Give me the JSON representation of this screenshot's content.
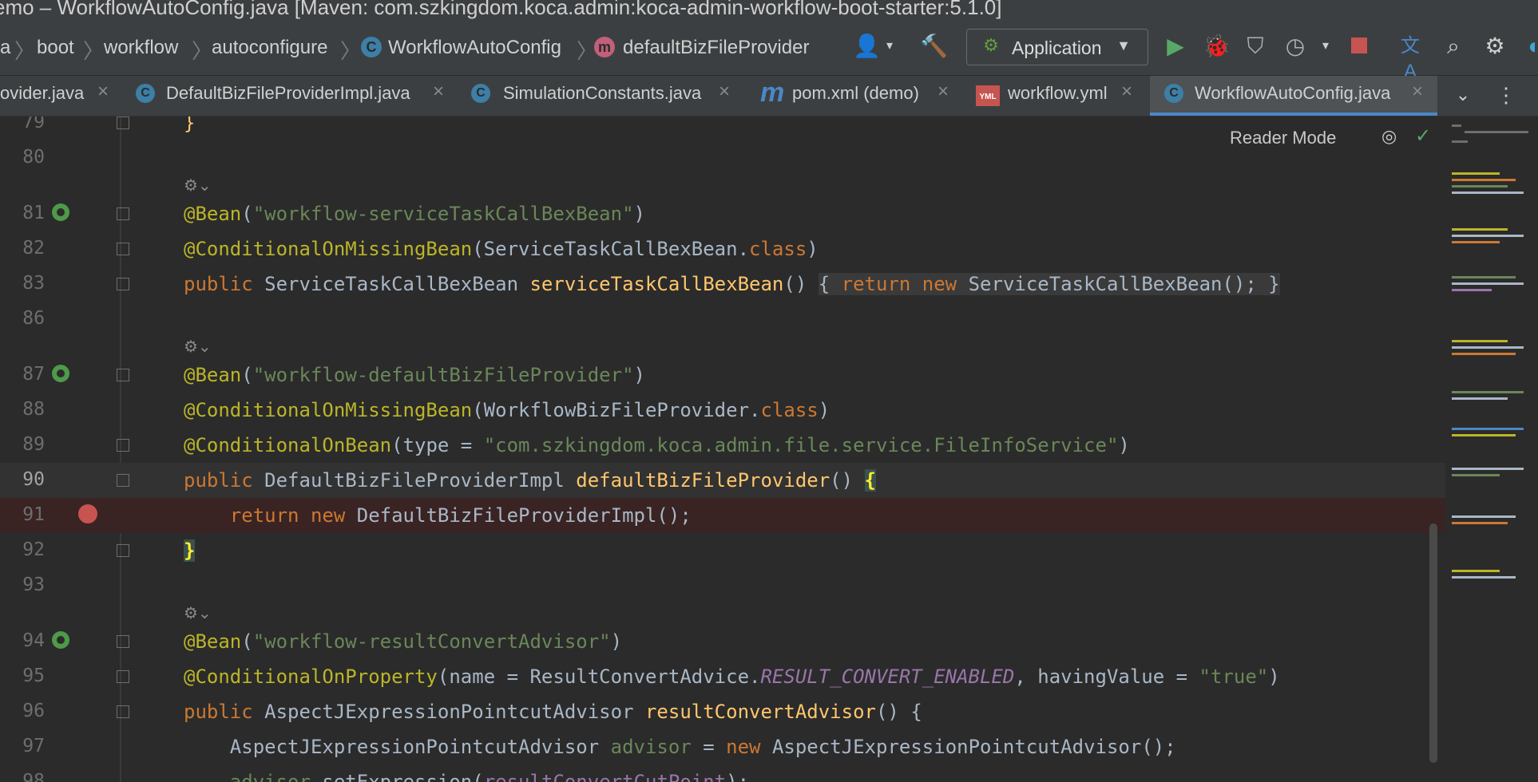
{
  "window": {
    "title": "emo – WorkflowAutoConfig.java [Maven: com.szkingdom.koca.admin:koca-admin-workflow-boot-starter:5.1.0]"
  },
  "breadcrumb": {
    "items": [
      "a",
      "boot",
      "workflow",
      "autoconfigure",
      "WorkflowAutoConfig",
      "defaultBizFileProvider"
    ],
    "class_icon": "C",
    "method_icon": "m"
  },
  "toolbar": {
    "run_config_label": "Application"
  },
  "tabs": [
    {
      "label": "ovider.java"
    },
    {
      "label": "DefaultBizFileProviderImpl.java",
      "icon": "C"
    },
    {
      "label": "SimulationConstants.java",
      "icon": "C"
    },
    {
      "label": "pom.xml (demo)",
      "icon": "m"
    },
    {
      "label": "workflow.yml",
      "icon": "YML"
    },
    {
      "label": "WorkflowAutoConfig.java",
      "icon": "C",
      "active": true
    }
  ],
  "editor": {
    "reader_mode_label": "Reader Mode",
    "lines": [
      {
        "n": "79",
        "text": "}"
      },
      {
        "n": "80",
        "text": ""
      },
      {
        "n": "81",
        "text": "@Bean(\"workflow-serviceTaskCallBexBean\")"
      },
      {
        "n": "82",
        "text": "@ConditionalOnMissingBean(ServiceTaskCallBexBean.class)"
      },
      {
        "n": "83",
        "text": "public ServiceTaskCallBexBean serviceTaskCallBexBean() { return new ServiceTaskCallBexBean(); }"
      },
      {
        "n": "86",
        "text": ""
      },
      {
        "n": "87",
        "text": "@Bean(\"workflow-defaultBizFileProvider\")"
      },
      {
        "n": "88",
        "text": "@ConditionalOnMissingBean(WorkflowBizFileProvider.class)"
      },
      {
        "n": "89",
        "text": "@ConditionalOnBean(type = \"com.szkingdom.koca.admin.file.service.FileInfoService\")"
      },
      {
        "n": "90",
        "text": "public DefaultBizFileProviderImpl defaultBizFileProvider() {"
      },
      {
        "n": "91",
        "text": "    return new DefaultBizFileProviderImpl();"
      },
      {
        "n": "92",
        "text": "}"
      },
      {
        "n": "93",
        "text": ""
      },
      {
        "n": "94",
        "text": "@Bean(\"workflow-resultConvertAdvisor\")"
      },
      {
        "n": "95",
        "text": "@ConditionalOnProperty(name = ResultConvertAdvice.RESULT_CONVERT_ENABLED, havingValue = \"true\")"
      },
      {
        "n": "96",
        "text": "public AspectJExpressionPointcutAdvisor resultConvertAdvisor() {"
      },
      {
        "n": "97",
        "text": "    AspectJExpressionPointcutAdvisor advisor = new AspectJExpressionPointcutAdvisor();"
      },
      {
        "n": "98",
        "text": "    advisor.setExpression(resultConvertCutPoint);"
      }
    ]
  },
  "colors": {
    "keyword": "#cc7832",
    "annotation": "#bbb529",
    "string": "#6a8759",
    "method": "#ffc66d",
    "constant": "#9876aa",
    "breakpoint": "#c75450",
    "active_tab_underline": "#4a88c7"
  }
}
